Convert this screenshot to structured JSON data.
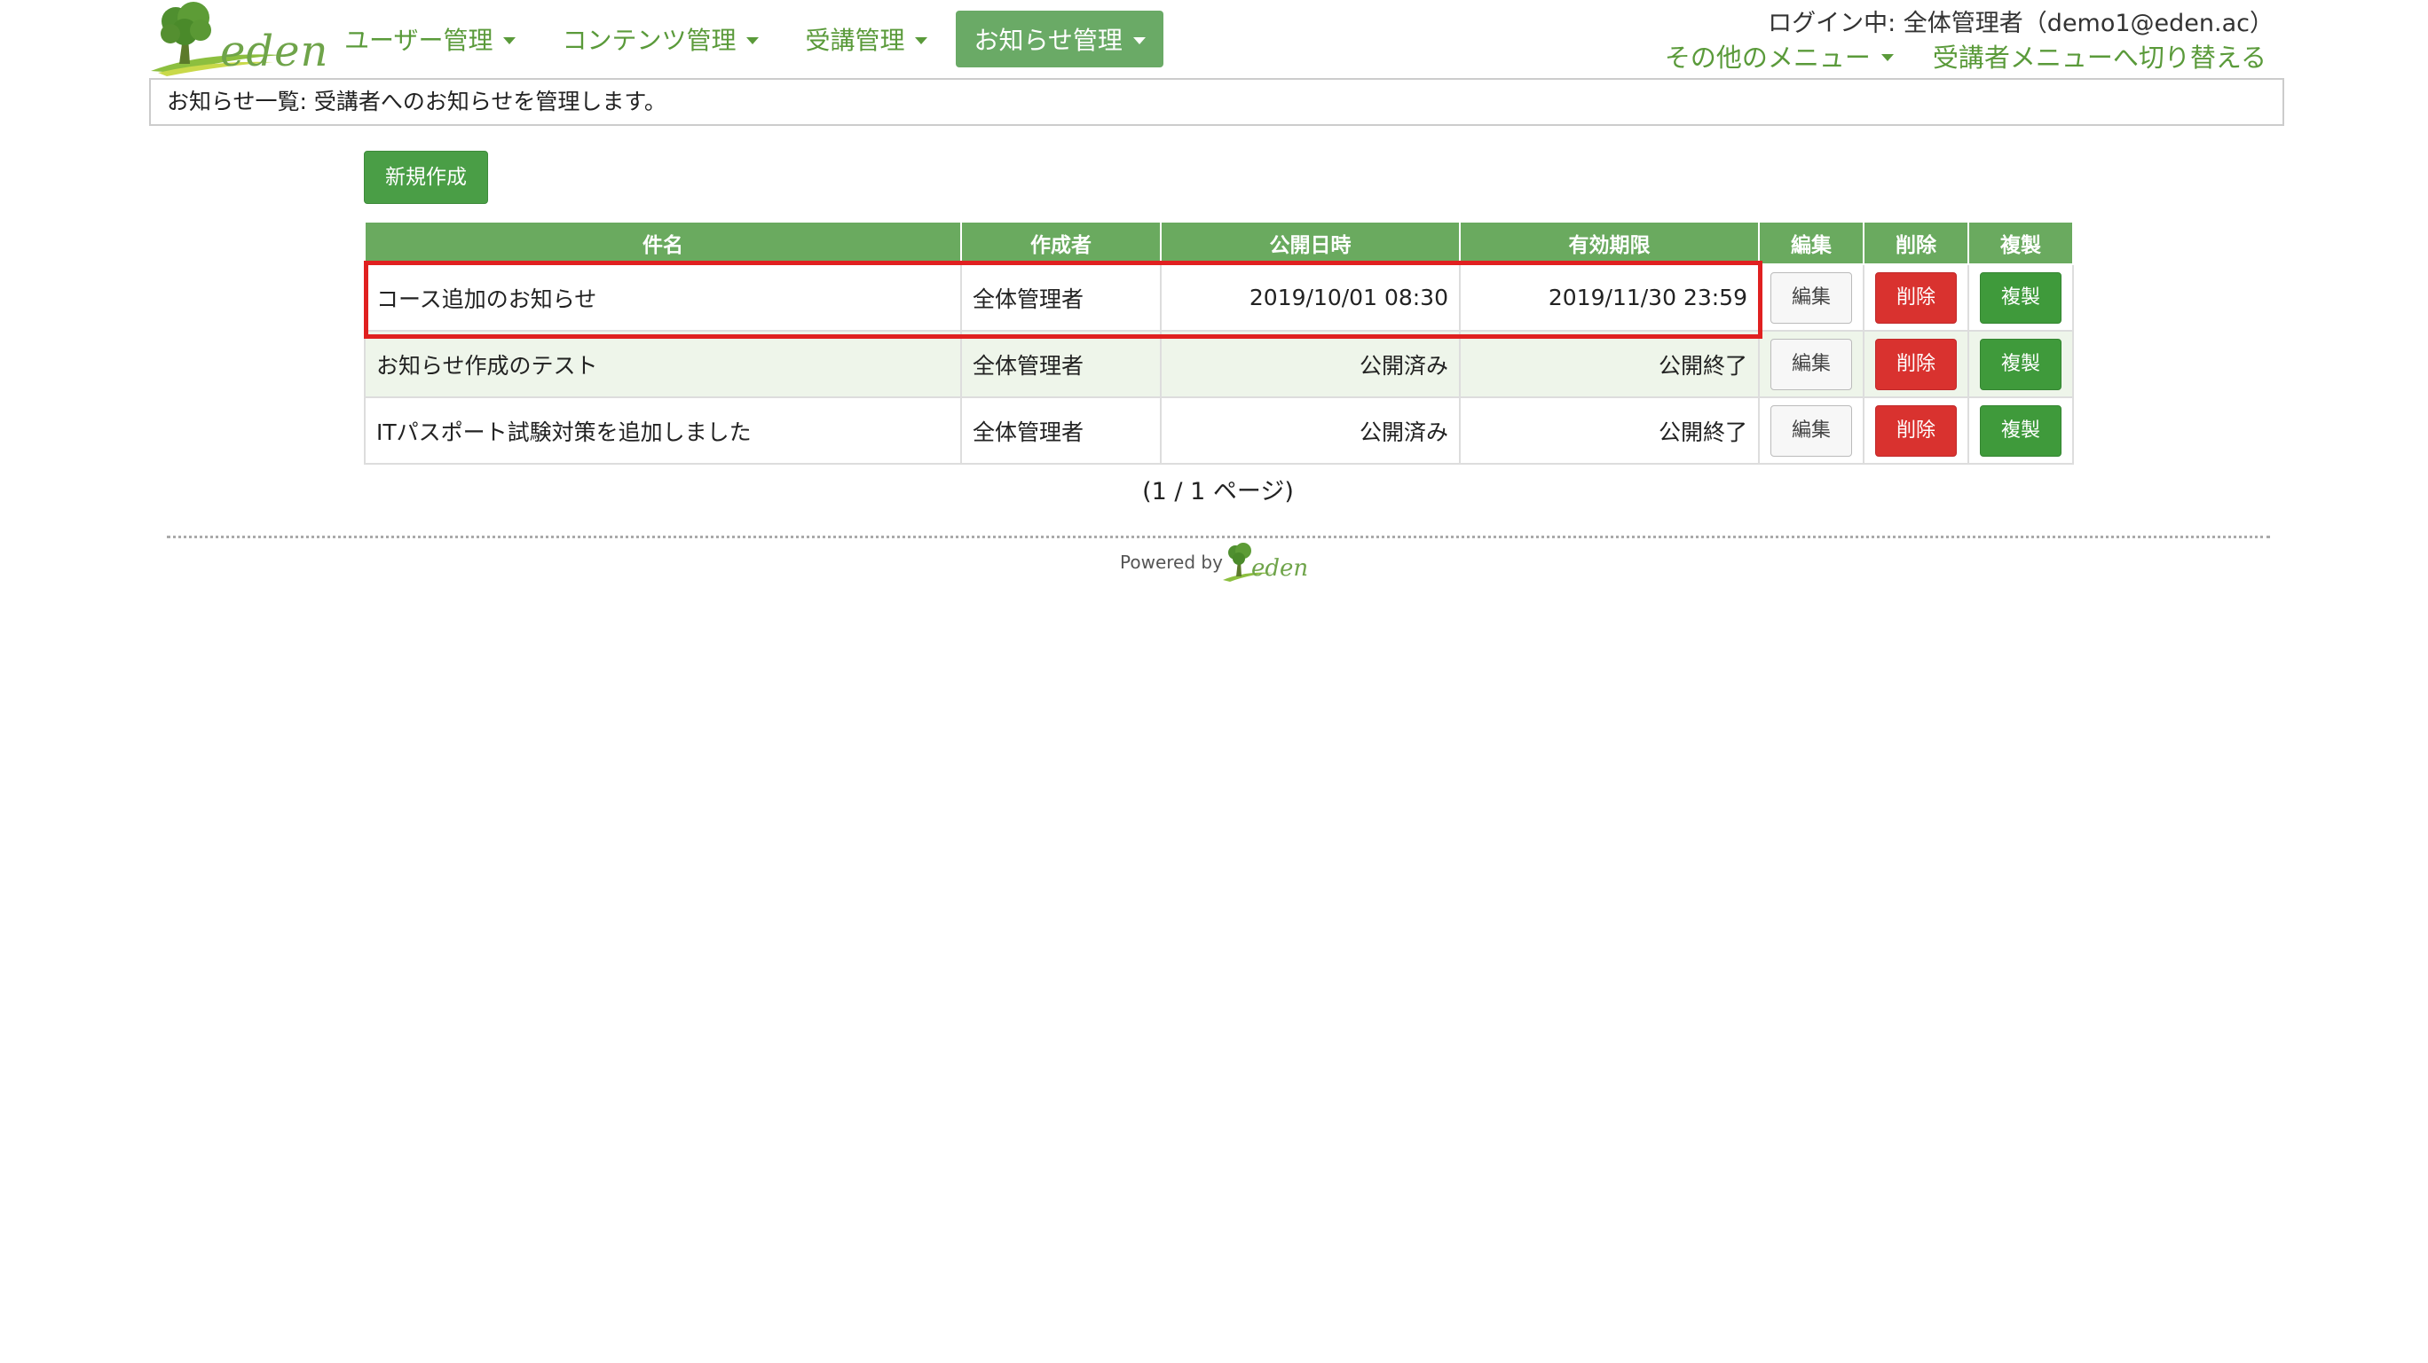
{
  "header": {
    "logo_text": "eden",
    "nav": [
      {
        "label": "ユーザー管理",
        "active": false
      },
      {
        "label": "コンテンツ管理",
        "active": false
      },
      {
        "label": "受講管理",
        "active": false
      },
      {
        "label": "お知らせ管理",
        "active": true
      }
    ],
    "login_info": "ログイン中: 全体管理者（demo1@eden.ac）",
    "right_nav": {
      "other_menu": "その他のメニュー",
      "switch_student": "受講者メニューへ切り替える"
    }
  },
  "description": "お知らせ一覧: 受講者へのお知らせを管理します。",
  "new_button": "新規作成",
  "table": {
    "headers": [
      "件名",
      "作成者",
      "公開日時",
      "有効期限",
      "編集",
      "削除",
      "複製"
    ],
    "rows": [
      {
        "subject": "コース追加のお知らせ",
        "author": "全体管理者",
        "publish": "2019/10/01 08:30",
        "expire": "2019/11/30 23:59",
        "edit": "編集",
        "delete": "削除",
        "copy": "複製"
      },
      {
        "subject": "お知らせ作成のテスト",
        "author": "全体管理者",
        "publish": "公開済み",
        "expire": "公開終了",
        "edit": "編集",
        "delete": "削除",
        "copy": "複製"
      },
      {
        "subject": "ITパスポート試験対策を追加しました",
        "author": "全体管理者",
        "publish": "公開済み",
        "expire": "公開終了",
        "edit": "編集",
        "delete": "削除",
        "copy": "複製"
      }
    ]
  },
  "pager": "(1 / 1 ページ)",
  "footer": {
    "powered_by": "Powered by",
    "logo_text": "eden"
  },
  "colors": {
    "brand_green": "#5a9a3a",
    "header_green": "#6aaa5f",
    "delete_red": "#d9322f",
    "copy_green": "#3f9a3b",
    "highlight_red": "#e02020"
  }
}
